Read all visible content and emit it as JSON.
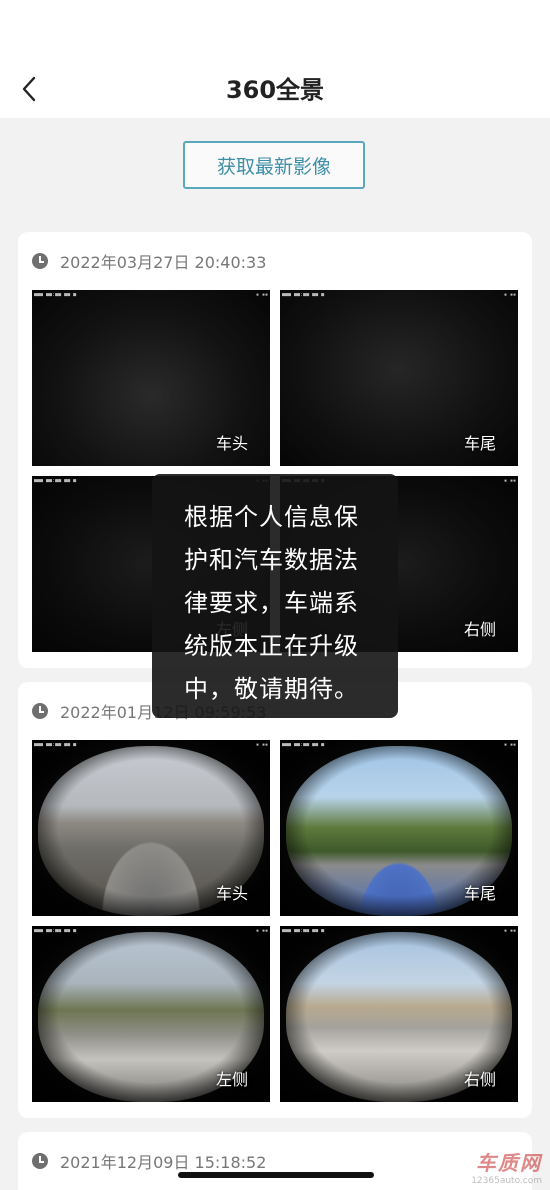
{
  "header": {
    "title": "360全景",
    "back_icon": "chevron-left-icon"
  },
  "fetch_button_label": "获取最新影像",
  "records": [
    {
      "timestamp": "2022年03月27日 20:40:33",
      "thumbs": [
        {
          "label": "车头"
        },
        {
          "label": "车尾"
        },
        {
          "label": "左侧"
        },
        {
          "label": "右侧"
        }
      ]
    },
    {
      "timestamp": "2022年01月12日 09:59:53",
      "thumbs": [
        {
          "label": "车头"
        },
        {
          "label": "车尾"
        },
        {
          "label": "左侧"
        },
        {
          "label": "右侧"
        }
      ]
    },
    {
      "timestamp": "2021年12月09日 15:18:52"
    }
  ],
  "toast": {
    "message": "根据个人信息保护和汽车数据法律要求，车端系统版本正在升级中，敬请期待。"
  },
  "watermark": {
    "main": "车质网",
    "sub": "12365auto.com"
  },
  "colors": {
    "accent": "#3d8ea6",
    "accent_border": "#5aa8bd",
    "background": "#f2f2f2",
    "toast_bg": "#141414"
  }
}
